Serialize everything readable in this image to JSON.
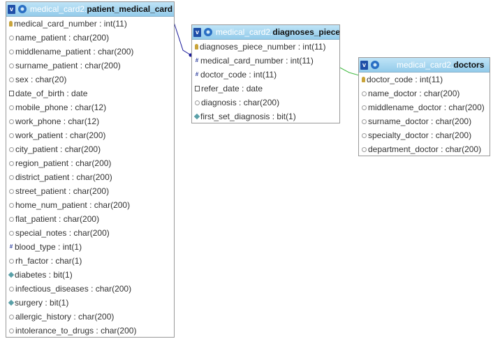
{
  "tables": [
    {
      "db": "medical_card2",
      "name": "patient_medical_card",
      "columns": [
        {
          "icon": "key-icon",
          "text": "medical_card_number : int(11)"
        },
        {
          "icon": "text-icon",
          "text": "name_patient : char(200)"
        },
        {
          "icon": "text-icon",
          "text": "middlename_patient : char(200)"
        },
        {
          "icon": "text-icon",
          "text": "surname_patient : char(200)"
        },
        {
          "icon": "text-icon",
          "text": "sex : char(20)"
        },
        {
          "icon": "date-icon",
          "text": "date_of_birth : date"
        },
        {
          "icon": "text-icon",
          "text": "mobile_phone : char(12)"
        },
        {
          "icon": "text-icon",
          "text": "work_phone : char(12)"
        },
        {
          "icon": "text-icon",
          "text": "work_patient : char(200)"
        },
        {
          "icon": "text-icon",
          "text": "city_patient : char(200)"
        },
        {
          "icon": "text-icon",
          "text": "region_patient : char(200)"
        },
        {
          "icon": "text-icon",
          "text": "district_patient : char(200)"
        },
        {
          "icon": "text-icon",
          "text": "street_patient : char(200)"
        },
        {
          "icon": "text-icon",
          "text": "home_num_patient : char(200)"
        },
        {
          "icon": "text-icon",
          "text": "flat_patient : char(200)"
        },
        {
          "icon": "text-icon",
          "text": "special_notes : char(200)"
        },
        {
          "icon": "number-icon",
          "text": "blood_type : int(1)"
        },
        {
          "icon": "text-icon",
          "text": "rh_factor : char(1)"
        },
        {
          "icon": "bit-icon",
          "text": "diabetes : bit(1)"
        },
        {
          "icon": "text-icon",
          "text": "infectious_diseases : char(200)"
        },
        {
          "icon": "bit-icon",
          "text": "surgery : bit(1)"
        },
        {
          "icon": "text-icon",
          "text": "allergic_history : char(200)"
        },
        {
          "icon": "text-icon",
          "text": "intolerance_to_drugs : char(200)"
        }
      ]
    },
    {
      "db": "medical_card2",
      "name": "diagnoses_piece",
      "columns": [
        {
          "icon": "key-icon",
          "text": "diagnoses_piece_number : int(11)"
        },
        {
          "icon": "number-icon",
          "text": "medical_card_number : int(11)"
        },
        {
          "icon": "number-icon",
          "text": "doctor_code : int(11)"
        },
        {
          "icon": "date-icon",
          "text": "refer_date : date"
        },
        {
          "icon": "text-icon",
          "text": "diagnosis : char(200)"
        },
        {
          "icon": "bit-icon",
          "text": "first_set_diagnosis : bit(1)"
        }
      ]
    },
    {
      "db": "medical_card2",
      "name": "doctors",
      "columns": [
        {
          "icon": "key-icon",
          "text": "doctor_code : int(11)"
        },
        {
          "icon": "text-icon",
          "text": "name_doctor : char(200)"
        },
        {
          "icon": "text-icon",
          "text": "middlename_doctor : char(200)"
        },
        {
          "icon": "text-icon",
          "text": "surname_doctor : char(200)"
        },
        {
          "icon": "text-icon",
          "text": "specialty_doctor : char(200)"
        },
        {
          "icon": "text-icon",
          "text": "department_doctor : char(200)"
        }
      ]
    }
  ],
  "relations": [
    {
      "from": "patient_medical_card.medical_card_number",
      "to": "diagnoses_piece.medical_card_number",
      "color": "#1a1a9a"
    },
    {
      "from": "doctors.doctor_code",
      "to": "diagnoses_piece.doctor_code",
      "color": "#44bb44"
    }
  ],
  "colors": {
    "header_top": "#bfe4f7",
    "header_bottom": "#93cbea",
    "toggle": "#1f4fa8"
  }
}
